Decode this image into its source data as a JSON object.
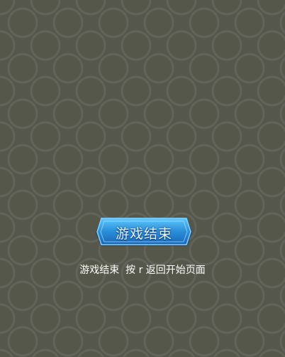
{
  "game": {
    "banner_title": "游戏结束",
    "hint_text": "游戏结束  按 r 返回开始页面"
  },
  "colors": {
    "background": "#55574a",
    "pattern": "#61635a",
    "banner_fill": "#2a8fd8",
    "banner_border": "#7fd3ff",
    "banner_text": "#e6f4ff",
    "hint_text": "#ffffff"
  }
}
